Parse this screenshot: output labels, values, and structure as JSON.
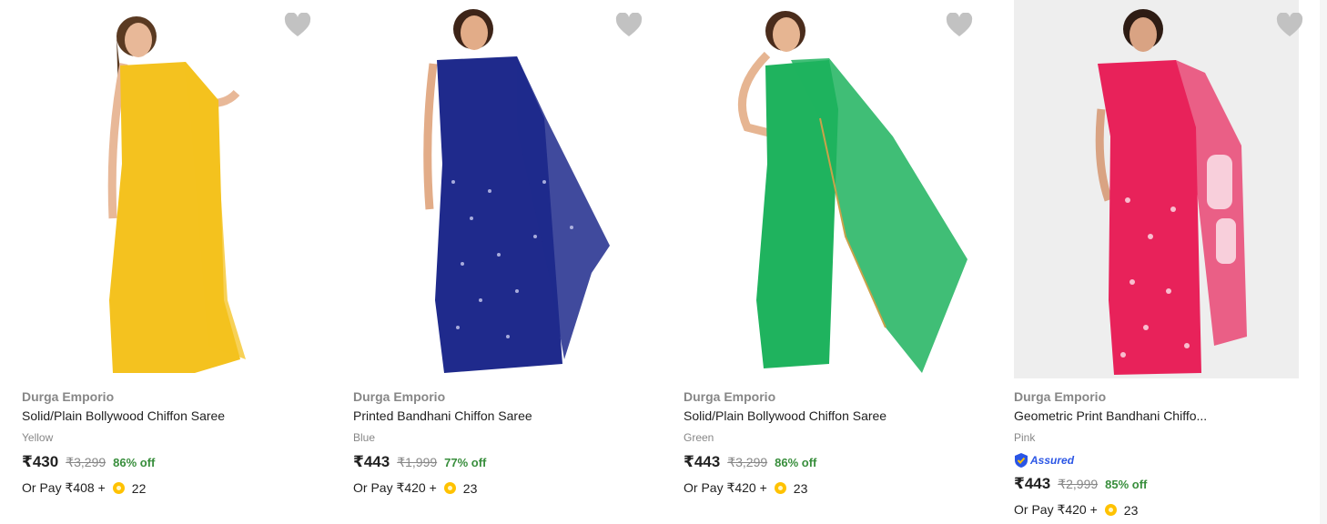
{
  "products": [
    {
      "brand": "Durga Emporio",
      "title": "Solid/Plain Bollywood Chiffon Saree",
      "color": "Yellow",
      "assured": false,
      "price": "₹430",
      "mrp": "₹3,299",
      "discount": "86% off",
      "pay_prefix": "Or Pay ₹408 +",
      "coins": "22",
      "saree_color": "#f4c21f"
    },
    {
      "brand": "Durga Emporio",
      "title": "Printed Bandhani Chiffon Saree",
      "color": "Blue",
      "assured": false,
      "price": "₹443",
      "mrp": "₹1,999",
      "discount": "77% off",
      "pay_prefix": "Or Pay ₹420 +",
      "coins": "23",
      "saree_color": "#1f2a8c"
    },
    {
      "brand": "Durga Emporio",
      "title": "Solid/Plain Bollywood Chiffon Saree",
      "color": "Green",
      "assured": false,
      "price": "₹443",
      "mrp": "₹3,299",
      "discount": "86% off",
      "pay_prefix": "Or Pay ₹420 +",
      "coins": "23",
      "saree_color": "#1fb35e"
    },
    {
      "brand": "Durga Emporio",
      "title": "Geometric Print Bandhani Chiffo...",
      "color": "Pink",
      "assured": true,
      "assured_label": "Assured",
      "price": "₹443",
      "mrp": "₹2,999",
      "discount": "85% off",
      "pay_prefix": "Or Pay ₹420 +",
      "coins": "23",
      "saree_color": "#e8225a"
    }
  ],
  "colors": {
    "discount_green": "#388e3c",
    "brand_grey": "#878787",
    "wishlist_grey": "#c2c2c2",
    "assured_blue": "#2a55e5",
    "coin_yellow": "#ffc200"
  }
}
